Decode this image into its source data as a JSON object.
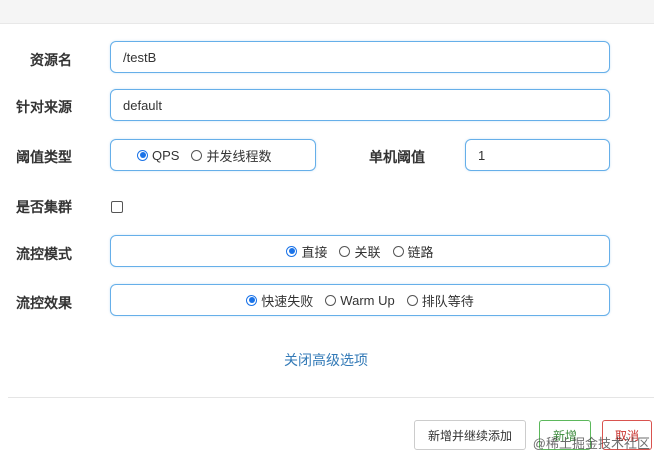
{
  "form": {
    "resource_name": {
      "label": "资源名",
      "value": "/testB"
    },
    "limit_app": {
      "label": "针对来源",
      "value": "default"
    },
    "threshold_type": {
      "label": "阈值类型",
      "options": [
        "QPS",
        "并发线程数"
      ],
      "selected": "QPS"
    },
    "threshold": {
      "label": "单机阈值",
      "value": "1"
    },
    "cluster": {
      "label": "是否集群",
      "checked": false
    },
    "flow_mode": {
      "label": "流控模式",
      "options": [
        "直接",
        "关联",
        "链路"
      ],
      "selected": "直接"
    },
    "flow_effect": {
      "label": "流控效果",
      "options": [
        "快速失败",
        "Warm Up",
        "排队等待"
      ],
      "selected": "快速失败"
    },
    "advanced_toggle": "关闭高级选项"
  },
  "footer": {
    "add_continue_label": "新增并继续添加",
    "add_label": "新增",
    "cancel_label": "取消"
  },
  "watermark": "@稀土掘金技术社区",
  "colors": {
    "accent": "#1a73e8",
    "border_focus": "#66afe9",
    "link": "#337ab7",
    "success": "#5cb85c",
    "danger": "#d9534f"
  }
}
